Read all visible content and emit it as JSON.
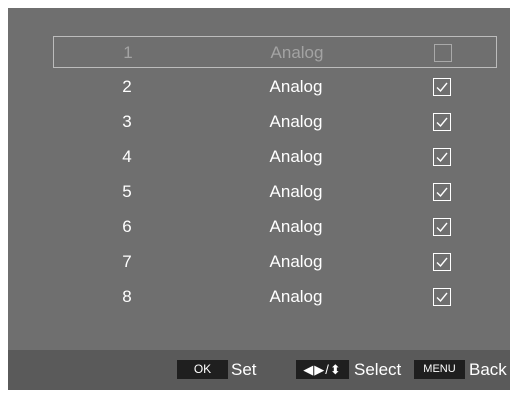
{
  "channels": [
    {
      "number": "1",
      "type": "Analog",
      "checked": false,
      "selected": true
    },
    {
      "number": "2",
      "type": "Analog",
      "checked": true,
      "selected": false
    },
    {
      "number": "3",
      "type": "Analog",
      "checked": true,
      "selected": false
    },
    {
      "number": "4",
      "type": "Analog",
      "checked": true,
      "selected": false
    },
    {
      "number": "5",
      "type": "Analog",
      "checked": true,
      "selected": false
    },
    {
      "number": "6",
      "type": "Analog",
      "checked": true,
      "selected": false
    },
    {
      "number": "7",
      "type": "Analog",
      "checked": true,
      "selected": false
    },
    {
      "number": "8",
      "type": "Analog",
      "checked": true,
      "selected": false
    }
  ],
  "footer": {
    "ok_key": "OK",
    "set_label": "Set",
    "nav_key": "◀▶/⬍",
    "select_label": "Select",
    "menu_key": "MENU",
    "back_label": "Back"
  },
  "icons": {
    "checkbox_checked": "check-icon",
    "checkbox_unchecked": "empty-checkbox-icon"
  },
  "colors": {
    "panel": "#6f6f6f",
    "footer": "#5a5a5a",
    "key_bg": "#1f1f1f",
    "text": "#ffffff",
    "selected_text": "#a3a3a3"
  }
}
